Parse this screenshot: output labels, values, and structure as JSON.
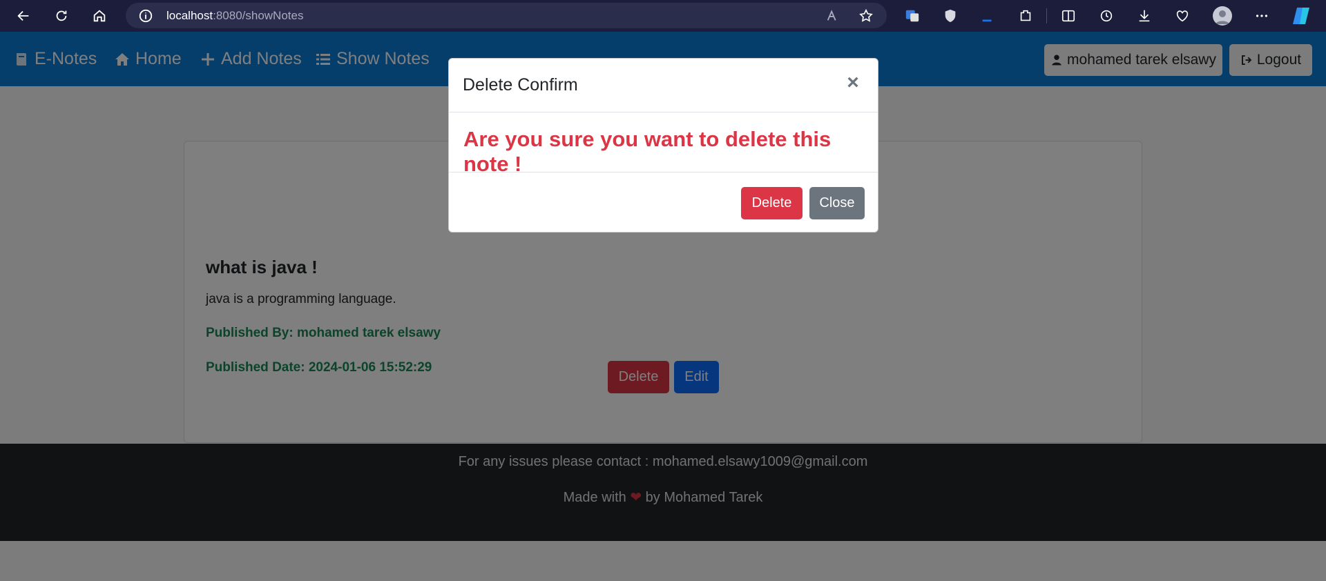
{
  "browser": {
    "url_host": "localhost",
    "url_rest": ":8080/showNotes"
  },
  "navbar": {
    "brand": "E-Notes",
    "links": [
      "Home",
      "Add Notes",
      "Show Notes"
    ],
    "user_label": "mohamed tarek elsawy",
    "logout_label": "Logout"
  },
  "note": {
    "title": "what is java !",
    "text": "java is a programming language.",
    "published_by": "Published By: mohamed tarek elsawy",
    "published_date": "Published Date: 2024-01-06 15:52:29",
    "delete_label": "Delete",
    "edit_label": "Edit"
  },
  "footer": {
    "contact": "For any issues please contact : mohamed.elsawy1009@gmail.com",
    "made_prefix": "Made with",
    "heart": "❤",
    "made_suffix": "by Mohamed Tarek"
  },
  "modal": {
    "title": "Delete Confirm",
    "close_symbol": "×",
    "message": "Are you sure you want to delete this note !",
    "delete_label": "Delete",
    "close_label": "Close"
  },
  "colors": {
    "navbar": "#0b7bd6",
    "danger": "#dc3545",
    "secondary": "#6c757d",
    "primary": "#0d6efd",
    "success": "#198754",
    "footer": "#212529"
  }
}
